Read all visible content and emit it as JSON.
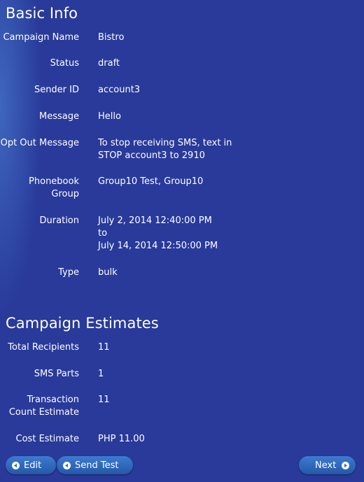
{
  "basic_info": {
    "title": "Basic Info",
    "campaign_name_label": "Campaign Name",
    "campaign_name": "Bistro",
    "status_label": "Status",
    "status": "draft",
    "sender_id_label": "Sender ID",
    "sender_id": "account3",
    "message_label": "Message",
    "message": "Hello",
    "opt_out_label": "Opt Out Message",
    "opt_out_line1": "To stop receiving SMS, text in",
    "opt_out_line2": "STOP account3 to 2910",
    "phonebook_label_line1": "Phonebook",
    "phonebook_label_line2": "Group",
    "phonebook_group": "Group10 Test, Group10",
    "duration_label": "Duration",
    "duration_start": "July 2, 2014 12:40:00 PM",
    "duration_to": "to",
    "duration_end": "July 14, 2014 12:50:00 PM",
    "type_label": "Type",
    "type": "bulk"
  },
  "estimates": {
    "title": "Campaign Estimates",
    "total_recipients_label": "Total Recipients",
    "total_recipients": "11",
    "sms_parts_label": "SMS Parts",
    "sms_parts": "1",
    "transaction_label_line1": "Transaction",
    "transaction_label_line2": "Count Estimate",
    "transaction_count": "11",
    "cost_label": "Cost Estimate",
    "cost": "PHP 11.00"
  },
  "buttons": {
    "edit": "Edit",
    "send_test": "Send Test",
    "next": "Next"
  },
  "icons": {
    "edit": "arrow-left-circle-icon",
    "send_test": "arrow-left-circle-icon",
    "next": "arrow-right-circle-icon"
  },
  "colors": {
    "background": "#293a9a",
    "button": "#2f6bc0"
  }
}
